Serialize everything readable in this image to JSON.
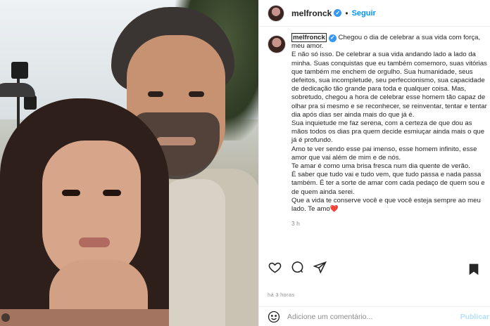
{
  "header": {
    "username": "melfronck",
    "separator": "•",
    "follow_label": "Seguir"
  },
  "caption": {
    "username": "melfronck",
    "paragraphs": [
      "Chegou o dia de celebrar a sua vida com força, meu amor.",
      "E não só isso. De celebrar a sua vida andando lado a lado da minha. Suas conquistas que eu também comemoro, suas vitórias que também me enchem de orgulho. Sua humanidade, seus defeitos, sua incompletude, seu perfeccionismo, sua capacidade de dedicação tão grande para toda e qualquer coisa. Mas, sobretudo, chegou a hora de celebrar esse homem tão capaz de olhar pra si mesmo e se reconhecer, se reinventar, tentar e tentar dia após dias ser ainda mais do que já é.",
      "Sua inquietude me faz serena, com a certeza de que dou as mãos todos os dias pra quem decide esmiuçar ainda mais o que já é profundo.",
      "Amo te ver sendo esse pai imenso, esse homem infinito, esse amor que vai além de mim e de nós.",
      "Te amar é como uma brisa fresca num dia quente de verão.",
      "É saber que tudo vai e tudo vem, que tudo passa e nada passa também. É ter a sorte de amar com cada pedaço de quem sou e de quem ainda serei.",
      "Que a vida te conserve você e que você esteja sempre ao meu lado. Te amo"
    ],
    "heart_emoji": "❤️",
    "time_ago": "3 h"
  },
  "actions": {
    "like_icon": "heart-outline-icon",
    "comment_icon": "comment-icon",
    "share_icon": "paper-plane-icon",
    "save_icon": "bookmark-icon"
  },
  "post_time": "há 3 horas",
  "comment": {
    "placeholder": "Adicione um comentário...",
    "publish_label": "Publicar"
  },
  "colors": {
    "link_blue": "#0095f6",
    "verified_blue": "#3897f0",
    "muted_text": "#8e8e8e",
    "publish_disabled": "#b2dffc"
  }
}
